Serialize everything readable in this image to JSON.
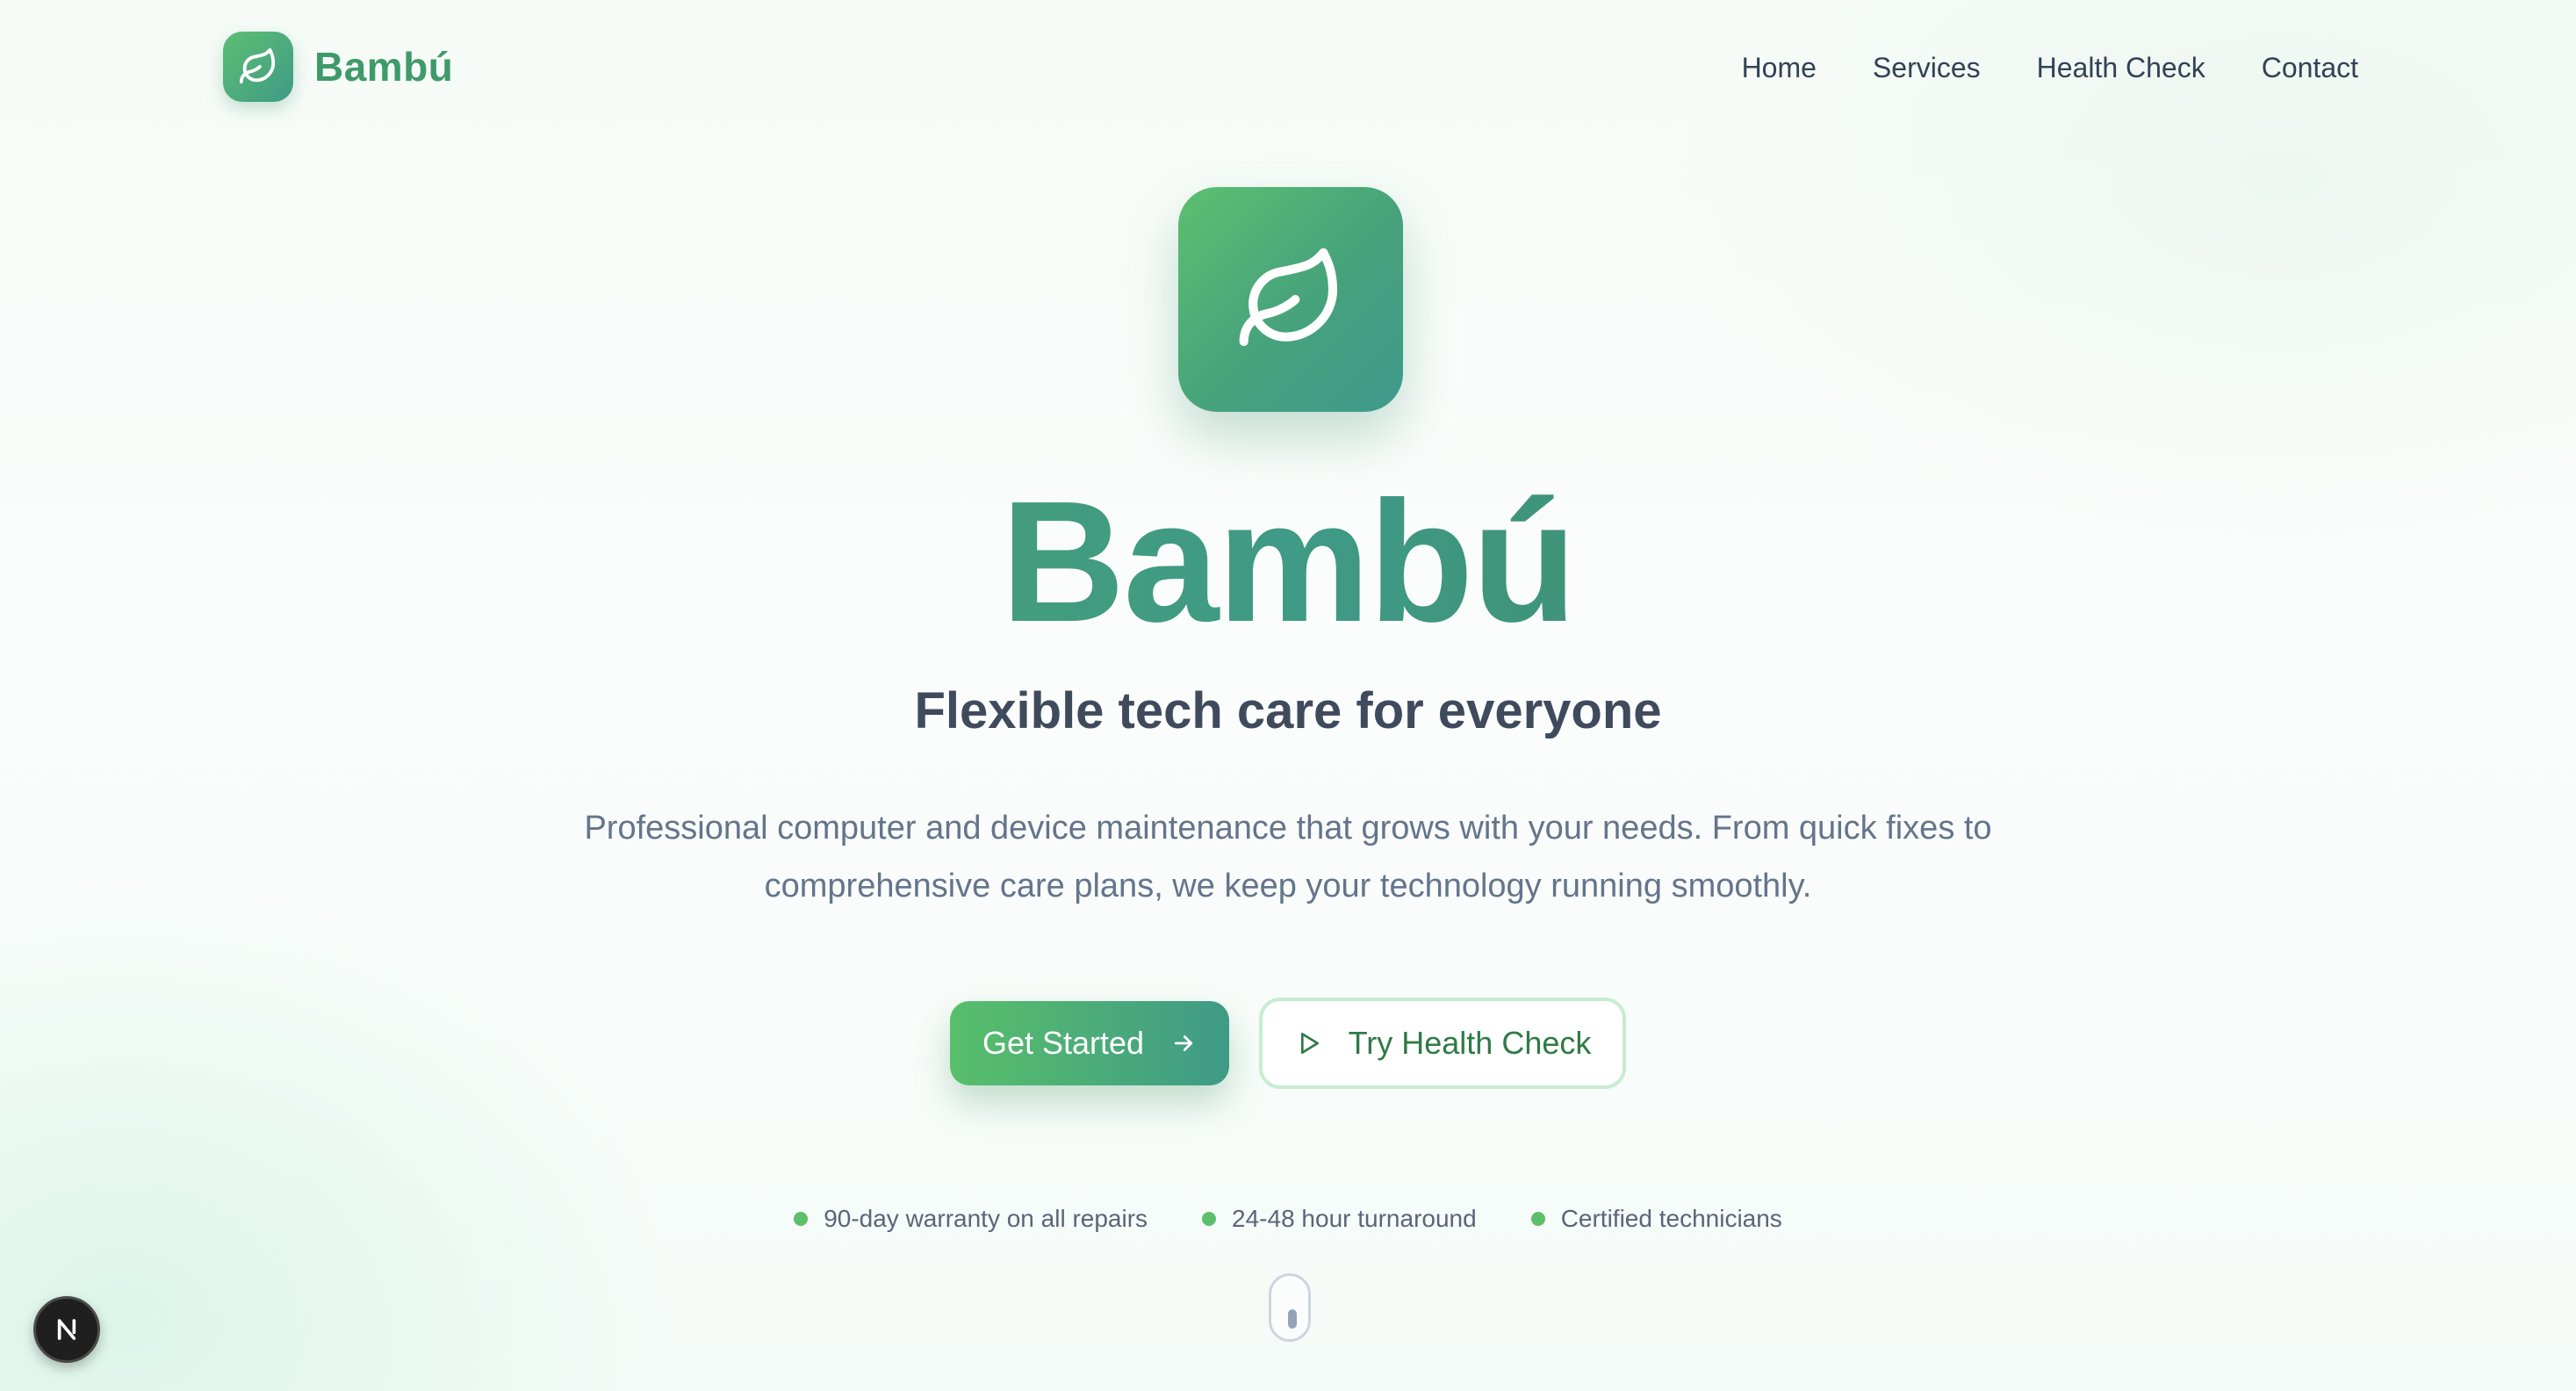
{
  "header": {
    "brand_name": "Bambú",
    "brand_icon": "leaf-icon",
    "nav": [
      "Home",
      "Services",
      "Health Check",
      "Contact"
    ]
  },
  "hero": {
    "icon": "leaf-icon",
    "title": "Bambú",
    "subtitle": "Flexible tech care for everyone",
    "description": "Professional computer and device maintenance that grows with your needs. From quick fixes to comprehensive care plans, we keep your technology running smoothly."
  },
  "cta": {
    "primary_label": "Get Started",
    "primary_icon": "arrow-right-icon",
    "secondary_label": "Try Health Check",
    "secondary_icon": "play-icon"
  },
  "features": [
    "90-day warranty on all repairs",
    "24-48 hour turnaround",
    "Certified technicians"
  ],
  "badge": {
    "letter": "N",
    "icon": "nextjs-icon"
  },
  "colors": {
    "brand_green": "#3f9a6a",
    "gradient_start": "#5cc070",
    "gradient_end": "#3f9a86",
    "text_dark": "#334155",
    "text_muted": "#64748b",
    "dot_green": "#5cbf6a"
  }
}
